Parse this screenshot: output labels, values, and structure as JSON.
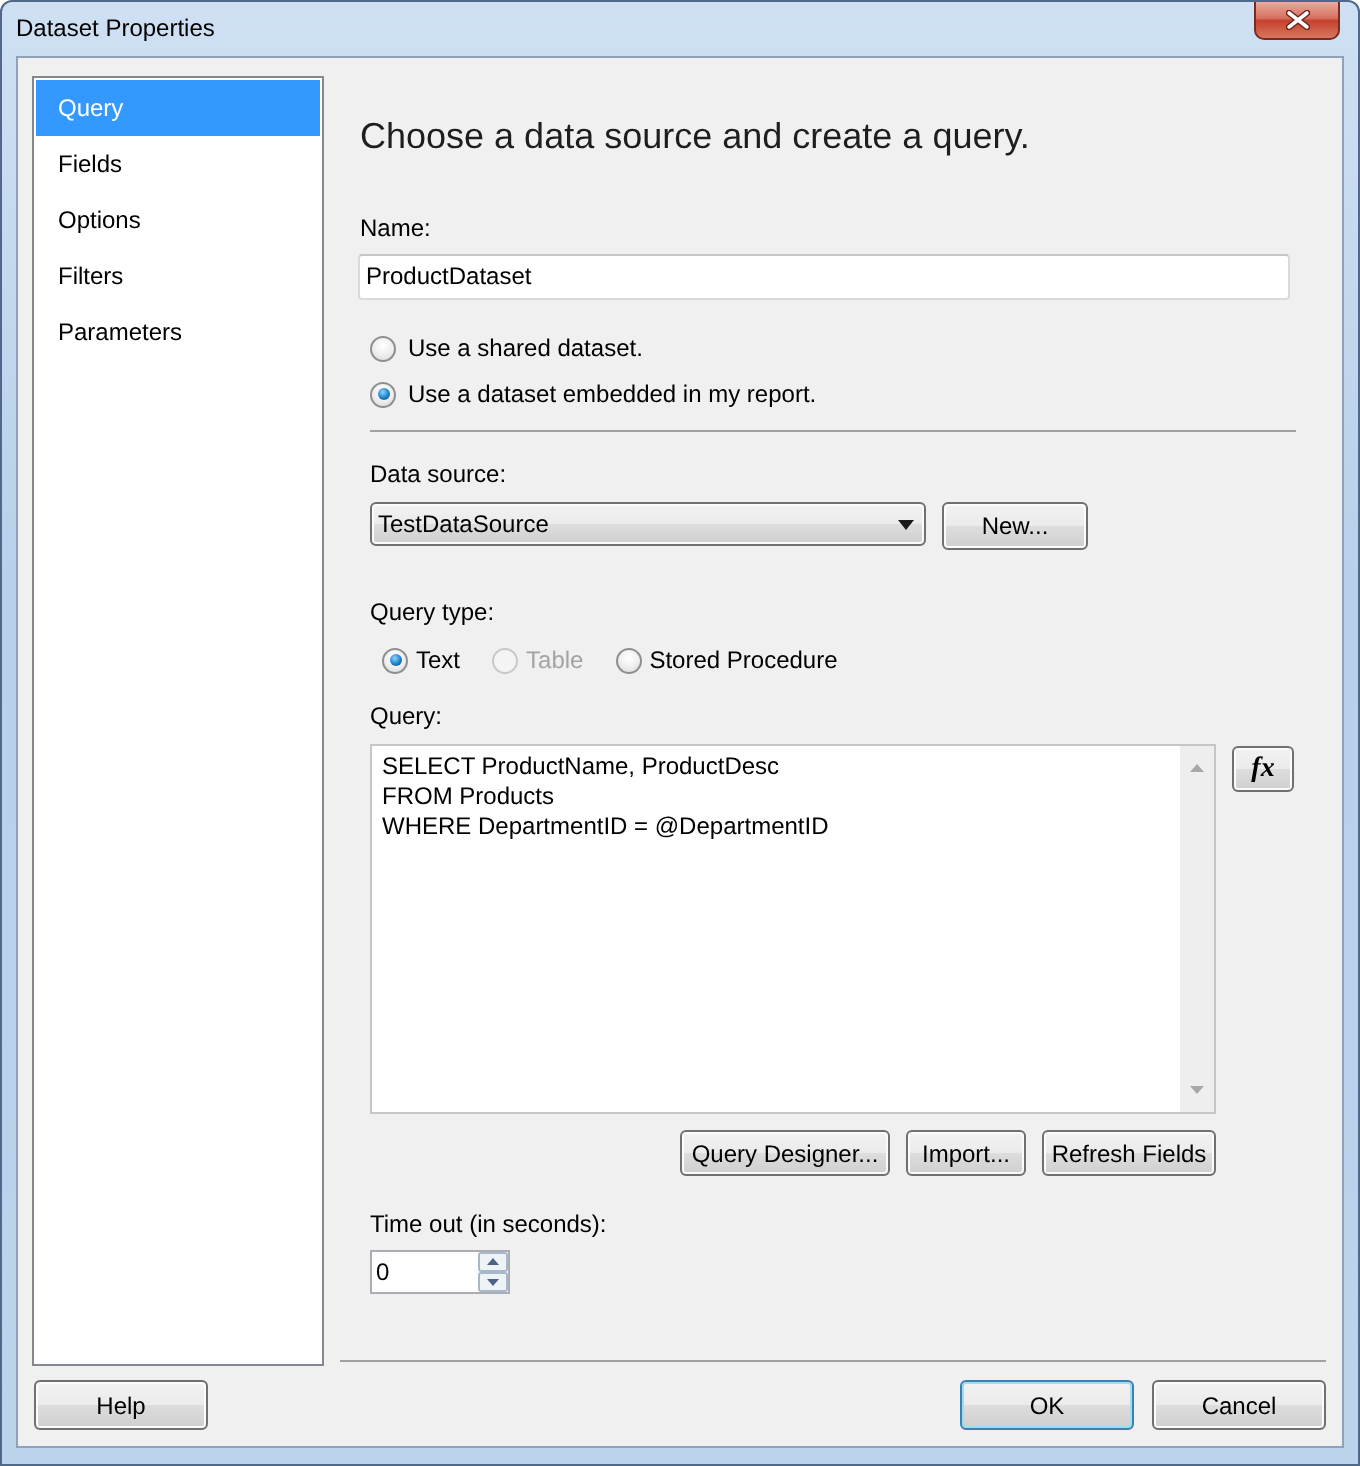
{
  "window": {
    "title": "Dataset Properties"
  },
  "sidebar": {
    "items": [
      {
        "label": "Query",
        "selected": true
      },
      {
        "label": "Fields",
        "selected": false
      },
      {
        "label": "Options",
        "selected": false
      },
      {
        "label": "Filters",
        "selected": false
      },
      {
        "label": "Parameters",
        "selected": false
      }
    ]
  },
  "heading": "Choose a data source and create a query.",
  "name": {
    "label": "Name:",
    "value": "ProductDataset"
  },
  "dataset_options": [
    {
      "label": "Use a shared dataset.",
      "selected": false
    },
    {
      "label": "Use a dataset embedded in my report.",
      "selected": true
    }
  ],
  "data_source": {
    "label": "Data source:",
    "value": "TestDataSource",
    "new_button": {
      "label": "New..."
    }
  },
  "query_type": {
    "label": "Query type:",
    "options": [
      {
        "label": "Text",
        "selected": true,
        "disabled": false
      },
      {
        "label": "Table",
        "selected": false,
        "disabled": true
      },
      {
        "label": "Stored Procedure",
        "selected": false,
        "disabled": false
      }
    ]
  },
  "query": {
    "label": "Query:",
    "value": "SELECT ProductName, ProductDesc\nFROM Products\nWHERE DepartmentID = @DepartmentID",
    "expression_button": "fx",
    "buttons": [
      {
        "label": "Query Designer..."
      },
      {
        "label": "Import..."
      },
      {
        "label": "Refresh Fields"
      }
    ]
  },
  "timeout": {
    "label": "Time out (in seconds):",
    "value": "0"
  },
  "help_button": {
    "label": "Help"
  },
  "dialog_buttons": [
    {
      "label": "OK",
      "default": true
    },
    {
      "label": "Cancel",
      "default": false
    }
  ]
}
